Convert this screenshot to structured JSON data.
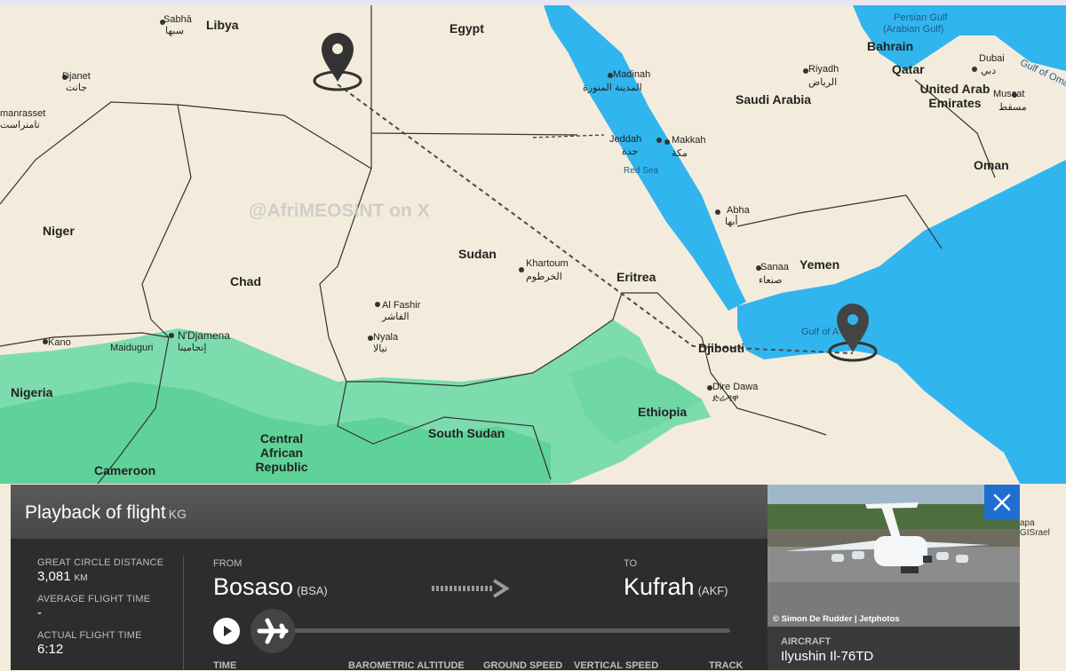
{
  "watermark": "@AfriMEOSINT on X",
  "map_labels": {
    "countries": [
      "Libya",
      "Egypt",
      "Saudi Arabia",
      "Bahrain",
      "Qatar",
      "United Arab Emirates",
      "Oman",
      "Yemen",
      "Eritrea",
      "Djibouti",
      "Ethiopia",
      "Sudan",
      "South Sudan",
      "Chad",
      "Niger",
      "Nigeria",
      "Cameroon",
      "Central African Republic"
    ],
    "cities": [
      "Sabhā",
      "سبها",
      "Djanet",
      "جانت",
      "manrasset",
      "تامنراست",
      "Madinah",
      "المدينة المنورة",
      "Riyadh",
      "الرياض",
      "Dubai",
      "دبي",
      "Muscat",
      "مسقط",
      "Jeddah",
      "جدة",
      "Makkah",
      "مكة",
      "Red Sea",
      "Abha",
      "أبها",
      "Sanaa",
      "صنعاء",
      "Khartoum",
      "الخرطوم",
      "Al Fashir",
      "الفاشر",
      "Nyala",
      "نيالا",
      "N'Djamena",
      "إنجامينا",
      "Kano",
      "Maiduguri",
      "Dire Dawa",
      "ድሬዳዋ",
      "Gulf of A",
      "Persian Gulf",
      "(Arabian Gulf)",
      "Gulf of Oman"
    ]
  },
  "attribution": "apa GISrael",
  "panel": {
    "title": "Playback of flight",
    "flight_code": "KG",
    "stats": {
      "distance_label": "GREAT CIRCLE DISTANCE",
      "distance_value": "3,081",
      "distance_unit": "KM",
      "avg_label": "AVERAGE FLIGHT TIME",
      "avg_value": "-",
      "actual_label": "ACTUAL FLIGHT TIME",
      "actual_value": "6:12"
    },
    "from_label": "FROM",
    "from_city": "Bosaso",
    "from_code": "(BSA)",
    "to_label": "TO",
    "to_city": "Kufrah",
    "to_code": "(AKF)",
    "columns": [
      "TIME",
      "BAROMETRIC ALTITUDE",
      "GROUND SPEED",
      "VERTICAL SPEED",
      "TRACK"
    ]
  },
  "aircraft": {
    "photo_credit": "© Simon De Rudder | Jetphotos",
    "label": "AIRCRAFT",
    "value": "Ilyushin Il-76TD"
  },
  "colors": {
    "accent": "#1f6fd1",
    "panel": "#2d2d2d",
    "sea": "#31b5ee",
    "land": "#f3ecdc",
    "green": "#6fd6a6"
  }
}
